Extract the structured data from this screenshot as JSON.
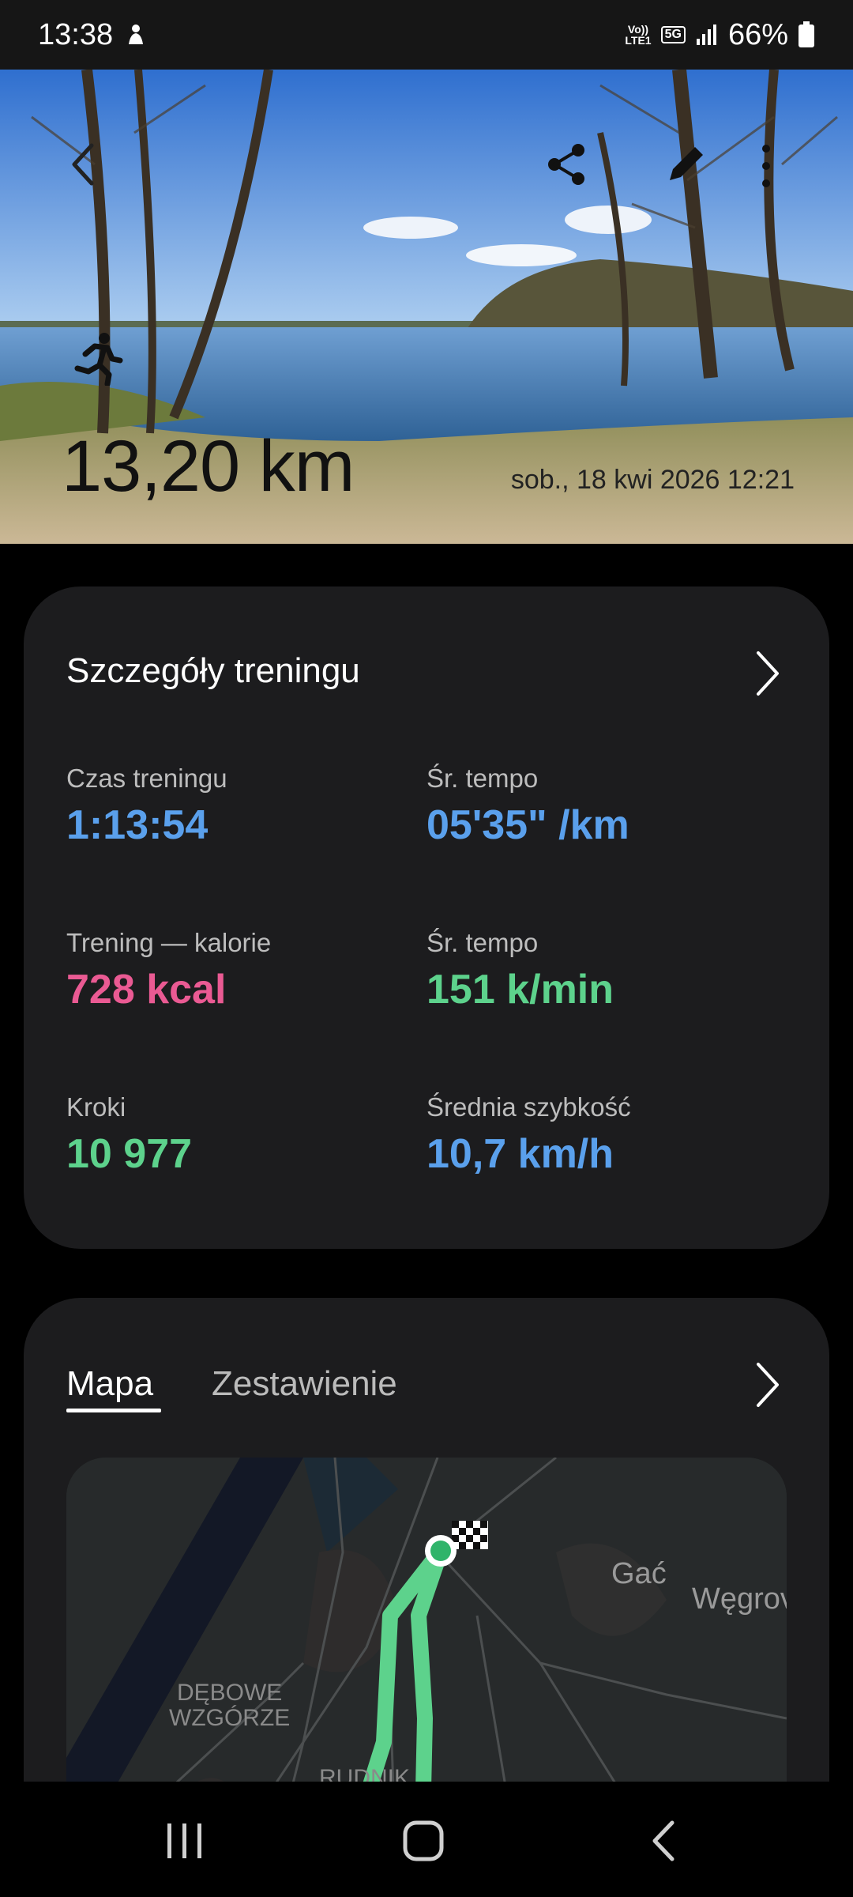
{
  "status_bar": {
    "time": "13:38",
    "volte": "Vo))",
    "lte": "LTE1",
    "network": "5G",
    "battery": "66%"
  },
  "hero": {
    "distance": "13,20 km",
    "datetime": "sob., 18 kwi 2026 12:21",
    "icons": [
      "back-icon",
      "share-icon",
      "edit-icon",
      "more-icon",
      "running-icon"
    ]
  },
  "details": {
    "title": "Szczegóły treningu",
    "metrics": [
      {
        "label": "Czas treningu",
        "value": "1:13:54",
        "color": "#5aa0ec"
      },
      {
        "label": "Śr. tempo",
        "value": "05'35\" /km",
        "color": "#5aa0ec"
      },
      {
        "label": "Trening — kalorie",
        "value": "728 kcal",
        "color": "#ea5a93"
      },
      {
        "label": "Śr. tempo",
        "value": "151 k/min",
        "color": "#5dd28c"
      },
      {
        "label": "Kroki",
        "value": "10 977",
        "color": "#5dd28c"
      },
      {
        "label": "Średnia szybkość",
        "value": "10,7 km/h",
        "color": "#5aa0ec"
      }
    ]
  },
  "map_card": {
    "tabs": [
      {
        "label": "Mapa",
        "active": true
      },
      {
        "label": "Zestawienie",
        "active": false
      }
    ],
    "map_labels": {
      "gac": "Gać",
      "wegrow": "Węgrov",
      "debowe": "DĘBOWE",
      "wzgorze": "WZGÓRZE",
      "rudnik": "RUDNIK"
    },
    "route_color": "#5dd28c"
  },
  "nav_bar": {
    "icons": [
      "recent-apps-icon",
      "home-icon",
      "back-nav-icon"
    ]
  }
}
